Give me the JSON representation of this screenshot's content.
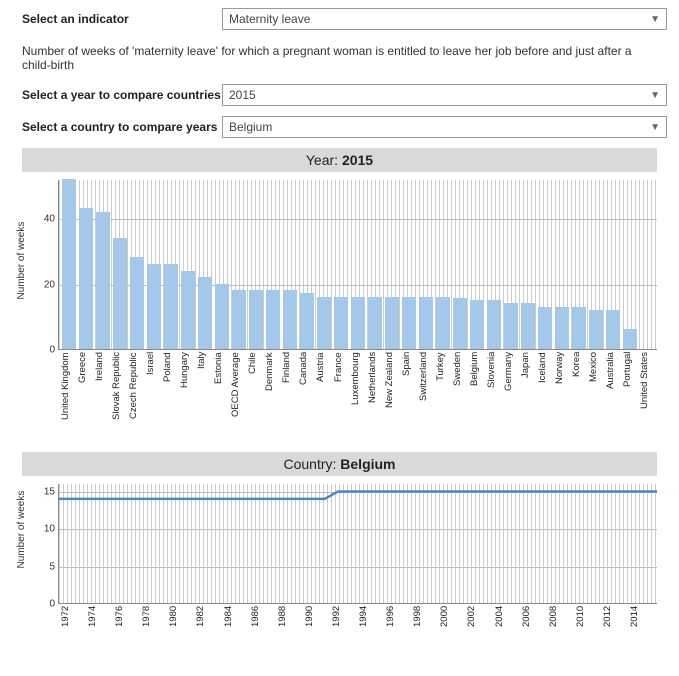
{
  "controls": {
    "indicator_label": "Select an indicator",
    "indicator_value": "Maternity leave",
    "description": "Number of weeks of 'maternity leave' for which a pregnant woman is entitled to leave her job before and just after a child-birth",
    "year_label": "Select a year to compare countries",
    "year_value": "2015",
    "country_label": "Select a country to compare years",
    "country_value": "Belgium"
  },
  "top_title_prefix": "Year: ",
  "top_title_value": "2015",
  "bottom_title_prefix": "Country: ",
  "bottom_title_value": "Belgium",
  "y_axis_label": "Number of weeks",
  "chart_data": [
    {
      "type": "bar",
      "title": "Year: 2015",
      "ylabel": "Number of weeks",
      "ylim": [
        0,
        52
      ],
      "yticks": [
        0,
        20,
        40
      ],
      "categories": [
        "United Kingdom",
        "Greece",
        "Ireland",
        "Slovak Republic",
        "Czech Republic",
        "Israel",
        "Poland",
        "Hungary",
        "Italy",
        "Estonia",
        "OECD Average",
        "Chile",
        "Denmark",
        "Finland",
        "Canada",
        "Austria",
        "France",
        "Luxembourg",
        "Netherlands",
        "New Zealand",
        "Spain",
        "Switzerland",
        "Turkey",
        "Sweden",
        "Belgium",
        "Slovenia",
        "Germany",
        "Japan",
        "Iceland",
        "Norway",
        "Korea",
        "Mexico",
        "Australia",
        "Portugal",
        "United States"
      ],
      "values": [
        52,
        43,
        42,
        34,
        28,
        26,
        26,
        24,
        22,
        20,
        18,
        18,
        18,
        18,
        17,
        16,
        16,
        16,
        16,
        16,
        16,
        16,
        16,
        15.5,
        15,
        15,
        14,
        14,
        13,
        13,
        13,
        12,
        12,
        6,
        0
      ]
    },
    {
      "type": "line",
      "title": "Country: Belgium",
      "ylabel": "Number of weeks",
      "ylim": [
        0,
        16
      ],
      "yticks": [
        0,
        5,
        10,
        15
      ],
      "x": [
        1970,
        1971,
        1972,
        1973,
        1974,
        1975,
        1976,
        1977,
        1978,
        1979,
        1980,
        1981,
        1982,
        1983,
        1984,
        1985,
        1986,
        1987,
        1988,
        1989,
        1990,
        1991,
        1992,
        1993,
        1994,
        1995,
        1996,
        1997,
        1998,
        1999,
        2000,
        2001,
        2002,
        2003,
        2004,
        2005,
        2006,
        2007,
        2008,
        2009,
        2010,
        2011,
        2012,
        2013,
        2014,
        2015
      ],
      "x_tick_labels": [
        "1972",
        "1974",
        "1976",
        "1978",
        "1980",
        "1982",
        "1984",
        "1986",
        "1988",
        "1990",
        "1992",
        "1994",
        "1996",
        "1998",
        "2000",
        "2002",
        "2004",
        "2006",
        "2008",
        "2010",
        "2012",
        "2014"
      ],
      "values": [
        14,
        14,
        14,
        14,
        14,
        14,
        14,
        14,
        14,
        14,
        14,
        14,
        14,
        14,
        14,
        14,
        14,
        14,
        14,
        14,
        14,
        15,
        15,
        15,
        15,
        15,
        15,
        15,
        15,
        15,
        15,
        15,
        15,
        15,
        15,
        15,
        15,
        15,
        15,
        15,
        15,
        15,
        15,
        15,
        15,
        15
      ]
    }
  ]
}
